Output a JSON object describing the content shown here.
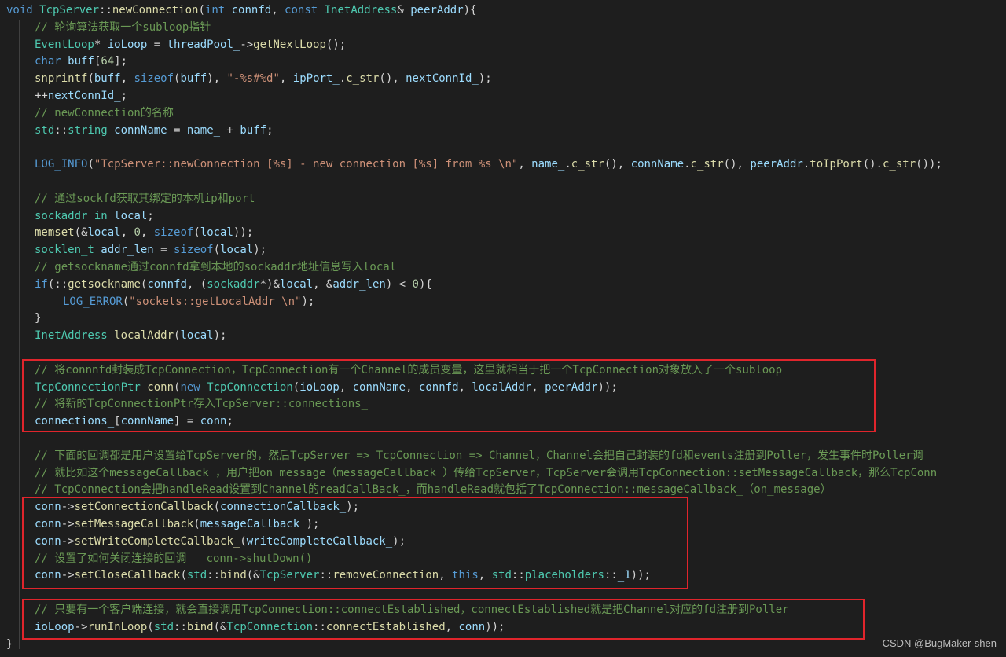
{
  "colors": {
    "background": "#1e1e1e",
    "default": "#d4d4d4",
    "keyword": "#569cd6",
    "function": "#dcdcaa",
    "type": "#4ec9b0",
    "variable": "#9cdcfe",
    "string": "#ce9178",
    "number": "#b5cea8",
    "comment": "#6a9955",
    "highlight_border": "#e0252c"
  },
  "watermark": "CSDN @BugMaker-shen",
  "code": [
    {
      "indent": 0,
      "t": [
        [
          "kw",
          "void "
        ],
        [
          "ty",
          "TcpServer"
        ],
        [
          "pl",
          "::"
        ],
        [
          "fn",
          "newConnection"
        ],
        [
          "pl",
          "("
        ],
        [
          "kw",
          "int "
        ],
        [
          "va",
          "connfd"
        ],
        [
          "pl",
          ", "
        ],
        [
          "kw",
          "const "
        ],
        [
          "ty",
          "InetAddress"
        ],
        [
          "pl",
          "& "
        ],
        [
          "va",
          "peerAddr"
        ],
        [
          "pl",
          "){"
        ]
      ]
    },
    {
      "indent": 1,
      "t": [
        [
          "cm",
          "// 轮询算法获取一个subloop指针"
        ]
      ]
    },
    {
      "indent": 1,
      "t": [
        [
          "ty",
          "EventLoop"
        ],
        [
          "pl",
          "* "
        ],
        [
          "va",
          "ioLoop"
        ],
        [
          "pl",
          " = "
        ],
        [
          "va",
          "threadPool_"
        ],
        [
          "pl",
          "->"
        ],
        [
          "fn",
          "getNextLoop"
        ],
        [
          "pl",
          "();"
        ]
      ]
    },
    {
      "indent": 1,
      "t": [
        [
          "kw",
          "char "
        ],
        [
          "va",
          "buff"
        ],
        [
          "pl",
          "["
        ],
        [
          "nu",
          "64"
        ],
        [
          "pl",
          "];"
        ]
      ]
    },
    {
      "indent": 1,
      "t": [
        [
          "fn",
          "snprintf"
        ],
        [
          "pl",
          "("
        ],
        [
          "va",
          "buff"
        ],
        [
          "pl",
          ", "
        ],
        [
          "kw",
          "sizeof"
        ],
        [
          "pl",
          "("
        ],
        [
          "va",
          "buff"
        ],
        [
          "pl",
          "), "
        ],
        [
          "st",
          "\"-%s#%d\""
        ],
        [
          "pl",
          ", "
        ],
        [
          "va",
          "ipPort_"
        ],
        [
          "pl",
          "."
        ],
        [
          "fn",
          "c_str"
        ],
        [
          "pl",
          "(), "
        ],
        [
          "va",
          "nextConnId_"
        ],
        [
          "pl",
          ");"
        ]
      ]
    },
    {
      "indent": 1,
      "t": [
        [
          "pl",
          "++"
        ],
        [
          "va",
          "nextConnId_"
        ],
        [
          "pl",
          ";"
        ]
      ]
    },
    {
      "indent": 1,
      "t": [
        [
          "cm",
          "// newConnection的名称"
        ]
      ]
    },
    {
      "indent": 1,
      "t": [
        [
          "ty",
          "std"
        ],
        [
          "pl",
          "::"
        ],
        [
          "ty",
          "string "
        ],
        [
          "va",
          "connName"
        ],
        [
          "pl",
          " = "
        ],
        [
          "va",
          "name_"
        ],
        [
          "pl",
          " + "
        ],
        [
          "va",
          "buff"
        ],
        [
          "pl",
          ";"
        ]
      ]
    },
    {
      "indent": 0,
      "t": []
    },
    {
      "indent": 1,
      "t": [
        [
          "kw",
          "LOG_INFO"
        ],
        [
          "pl",
          "("
        ],
        [
          "st",
          "\"TcpServer::newConnection [%s] - new connection [%s] from %s \\n\""
        ],
        [
          "pl",
          ", "
        ],
        [
          "va",
          "name_"
        ],
        [
          "pl",
          "."
        ],
        [
          "fn",
          "c_str"
        ],
        [
          "pl",
          "(), "
        ],
        [
          "va",
          "connName"
        ],
        [
          "pl",
          "."
        ],
        [
          "fn",
          "c_str"
        ],
        [
          "pl",
          "(), "
        ],
        [
          "va",
          "peerAddr"
        ],
        [
          "pl",
          "."
        ],
        [
          "fn",
          "toIpPort"
        ],
        [
          "pl",
          "()."
        ],
        [
          "fn",
          "c_str"
        ],
        [
          "pl",
          "());"
        ]
      ]
    },
    {
      "indent": 0,
      "t": []
    },
    {
      "indent": 1,
      "t": [
        [
          "cm",
          "// 通过sockfd获取其绑定的本机ip和port"
        ]
      ]
    },
    {
      "indent": 1,
      "t": [
        [
          "ty",
          "sockaddr_in "
        ],
        [
          "va",
          "local"
        ],
        [
          "pl",
          ";"
        ]
      ]
    },
    {
      "indent": 1,
      "t": [
        [
          "fn",
          "memset"
        ],
        [
          "pl",
          "(&"
        ],
        [
          "va",
          "local"
        ],
        [
          "pl",
          ", "
        ],
        [
          "nu",
          "0"
        ],
        [
          "pl",
          ", "
        ],
        [
          "kw",
          "sizeof"
        ],
        [
          "pl",
          "("
        ],
        [
          "va",
          "local"
        ],
        [
          "pl",
          "));"
        ]
      ]
    },
    {
      "indent": 1,
      "t": [
        [
          "ty",
          "socklen_t "
        ],
        [
          "va",
          "addr_len"
        ],
        [
          "pl",
          " = "
        ],
        [
          "kw",
          "sizeof"
        ],
        [
          "pl",
          "("
        ],
        [
          "va",
          "local"
        ],
        [
          "pl",
          ");"
        ]
      ]
    },
    {
      "indent": 1,
      "t": [
        [
          "cm",
          "// getsockname通过connfd拿到本地的sockaddr地址信息写入local"
        ]
      ]
    },
    {
      "indent": 1,
      "t": [
        [
          "kw",
          "if"
        ],
        [
          "pl",
          "(::"
        ],
        [
          "fn",
          "getsockname"
        ],
        [
          "pl",
          "("
        ],
        [
          "va",
          "connfd"
        ],
        [
          "pl",
          ", ("
        ],
        [
          "ty",
          "sockaddr"
        ],
        [
          "pl",
          "*)&"
        ],
        [
          "va",
          "local"
        ],
        [
          "pl",
          ", &"
        ],
        [
          "va",
          "addr_len"
        ],
        [
          "pl",
          ") < "
        ],
        [
          "nu",
          "0"
        ],
        [
          "pl",
          "){"
        ]
      ]
    },
    {
      "indent": 2,
      "t": [
        [
          "kw",
          "LOG_ERROR"
        ],
        [
          "pl",
          "("
        ],
        [
          "st",
          "\"sockets::getLocalAddr \\n\""
        ],
        [
          "pl",
          ");"
        ]
      ]
    },
    {
      "indent": 1,
      "t": [
        [
          "pl",
          "}"
        ]
      ]
    },
    {
      "indent": 1,
      "t": [
        [
          "ty",
          "InetAddress "
        ],
        [
          "fn",
          "localAddr"
        ],
        [
          "pl",
          "("
        ],
        [
          "va",
          "local"
        ],
        [
          "pl",
          ");"
        ]
      ]
    },
    {
      "indent": 0,
      "t": []
    },
    {
      "indent": 1,
      "t": [
        [
          "cm",
          "// 将connnfd封装成TcpConnection，TcpConnection有一个Channel的成员变量，这里就相当于把一个TcpConnection对象放入了一个subloop"
        ]
      ]
    },
    {
      "indent": 1,
      "t": [
        [
          "ty",
          "TcpConnectionPtr "
        ],
        [
          "fn",
          "conn"
        ],
        [
          "pl",
          "("
        ],
        [
          "kw",
          "new "
        ],
        [
          "ty",
          "TcpConnection"
        ],
        [
          "pl",
          "("
        ],
        [
          "va",
          "ioLoop"
        ],
        [
          "pl",
          ", "
        ],
        [
          "va",
          "connName"
        ],
        [
          "pl",
          ", "
        ],
        [
          "va",
          "connfd"
        ],
        [
          "pl",
          ", "
        ],
        [
          "va",
          "localAddr"
        ],
        [
          "pl",
          ", "
        ],
        [
          "va",
          "peerAddr"
        ],
        [
          "pl",
          "));"
        ]
      ]
    },
    {
      "indent": 1,
      "t": [
        [
          "cm",
          "// 将新的TcpConnectionPtr存入TcpServer::connections_"
        ]
      ]
    },
    {
      "indent": 1,
      "t": [
        [
          "va",
          "connections_"
        ],
        [
          "pl",
          "["
        ],
        [
          "va",
          "connName"
        ],
        [
          "pl",
          "] = "
        ],
        [
          "va",
          "conn"
        ],
        [
          "pl",
          ";"
        ]
      ]
    },
    {
      "indent": 0,
      "t": []
    },
    {
      "indent": 1,
      "t": [
        [
          "cm",
          "// 下面的回调都是用户设置给TcpServer的，然后TcpServer => TcpConnection => Channel，Channel会把自己封装的fd和events注册到Poller，发生事件时Poller调"
        ]
      ]
    },
    {
      "indent": 1,
      "t": [
        [
          "cm",
          "// 就比如这个messageCallback_，用户把on_message（messageCallback_）传给TcpServer，TcpServer会调用TcpConnection::setMessageCallback，那么TcpConn"
        ]
      ]
    },
    {
      "indent": 1,
      "t": [
        [
          "cm",
          "// TcpConnection会把handleRead设置到Channel的readCallBack_，而handleRead就包括了TcpConnection::messageCallback_（on_message）"
        ]
      ]
    },
    {
      "indent": 1,
      "t": [
        [
          "va",
          "conn"
        ],
        [
          "pl",
          "->"
        ],
        [
          "fn",
          "setConnectionCallback"
        ],
        [
          "pl",
          "("
        ],
        [
          "va",
          "connectionCallback_"
        ],
        [
          "pl",
          ");"
        ]
      ]
    },
    {
      "indent": 1,
      "t": [
        [
          "va",
          "conn"
        ],
        [
          "pl",
          "->"
        ],
        [
          "fn",
          "setMessageCallback"
        ],
        [
          "pl",
          "("
        ],
        [
          "va",
          "messageCallback_"
        ],
        [
          "pl",
          ");"
        ]
      ]
    },
    {
      "indent": 1,
      "t": [
        [
          "va",
          "conn"
        ],
        [
          "pl",
          "->"
        ],
        [
          "fn",
          "setWriteCompleteCallback_"
        ],
        [
          "pl",
          "("
        ],
        [
          "va",
          "writeCompleteCallback_"
        ],
        [
          "pl",
          ");"
        ]
      ]
    },
    {
      "indent": 1,
      "t": [
        [
          "cm",
          "// 设置了如何关闭连接的回调   conn->shutDown()"
        ]
      ]
    },
    {
      "indent": 1,
      "t": [
        [
          "va",
          "conn"
        ],
        [
          "pl",
          "->"
        ],
        [
          "fn",
          "setCloseCallback"
        ],
        [
          "pl",
          "("
        ],
        [
          "ty",
          "std"
        ],
        [
          "pl",
          "::"
        ],
        [
          "fn",
          "bind"
        ],
        [
          "pl",
          "(&"
        ],
        [
          "ty",
          "TcpServer"
        ],
        [
          "pl",
          "::"
        ],
        [
          "fn",
          "removeConnection"
        ],
        [
          "pl",
          ", "
        ],
        [
          "kw",
          "this"
        ],
        [
          "pl",
          ", "
        ],
        [
          "ty",
          "std"
        ],
        [
          "pl",
          "::"
        ],
        [
          "ty",
          "placeholders"
        ],
        [
          "pl",
          "::"
        ],
        [
          "va",
          "_1"
        ],
        [
          "pl",
          "));"
        ]
      ]
    },
    {
      "indent": 0,
      "t": []
    },
    {
      "indent": 1,
      "t": [
        [
          "cm",
          "// 只要有一个客户端连接，就会直接调用TcpConnection::connectEstablished，connectEstablished就是把Channel对应的fd注册到Poller"
        ]
      ]
    },
    {
      "indent": 1,
      "t": [
        [
          "va",
          "ioLoop"
        ],
        [
          "pl",
          "->"
        ],
        [
          "fn",
          "runInLoop"
        ],
        [
          "pl",
          "("
        ],
        [
          "ty",
          "std"
        ],
        [
          "pl",
          "::"
        ],
        [
          "fn",
          "bind"
        ],
        [
          "pl",
          "(&"
        ],
        [
          "ty",
          "TcpConnection"
        ],
        [
          "pl",
          "::"
        ],
        [
          "fn",
          "connectEstablished"
        ],
        [
          "pl",
          ", "
        ],
        [
          "va",
          "conn"
        ],
        [
          "pl",
          "));"
        ]
      ]
    },
    {
      "indent": 0,
      "t": [
        [
          "pl",
          "}"
        ]
      ]
    }
  ]
}
